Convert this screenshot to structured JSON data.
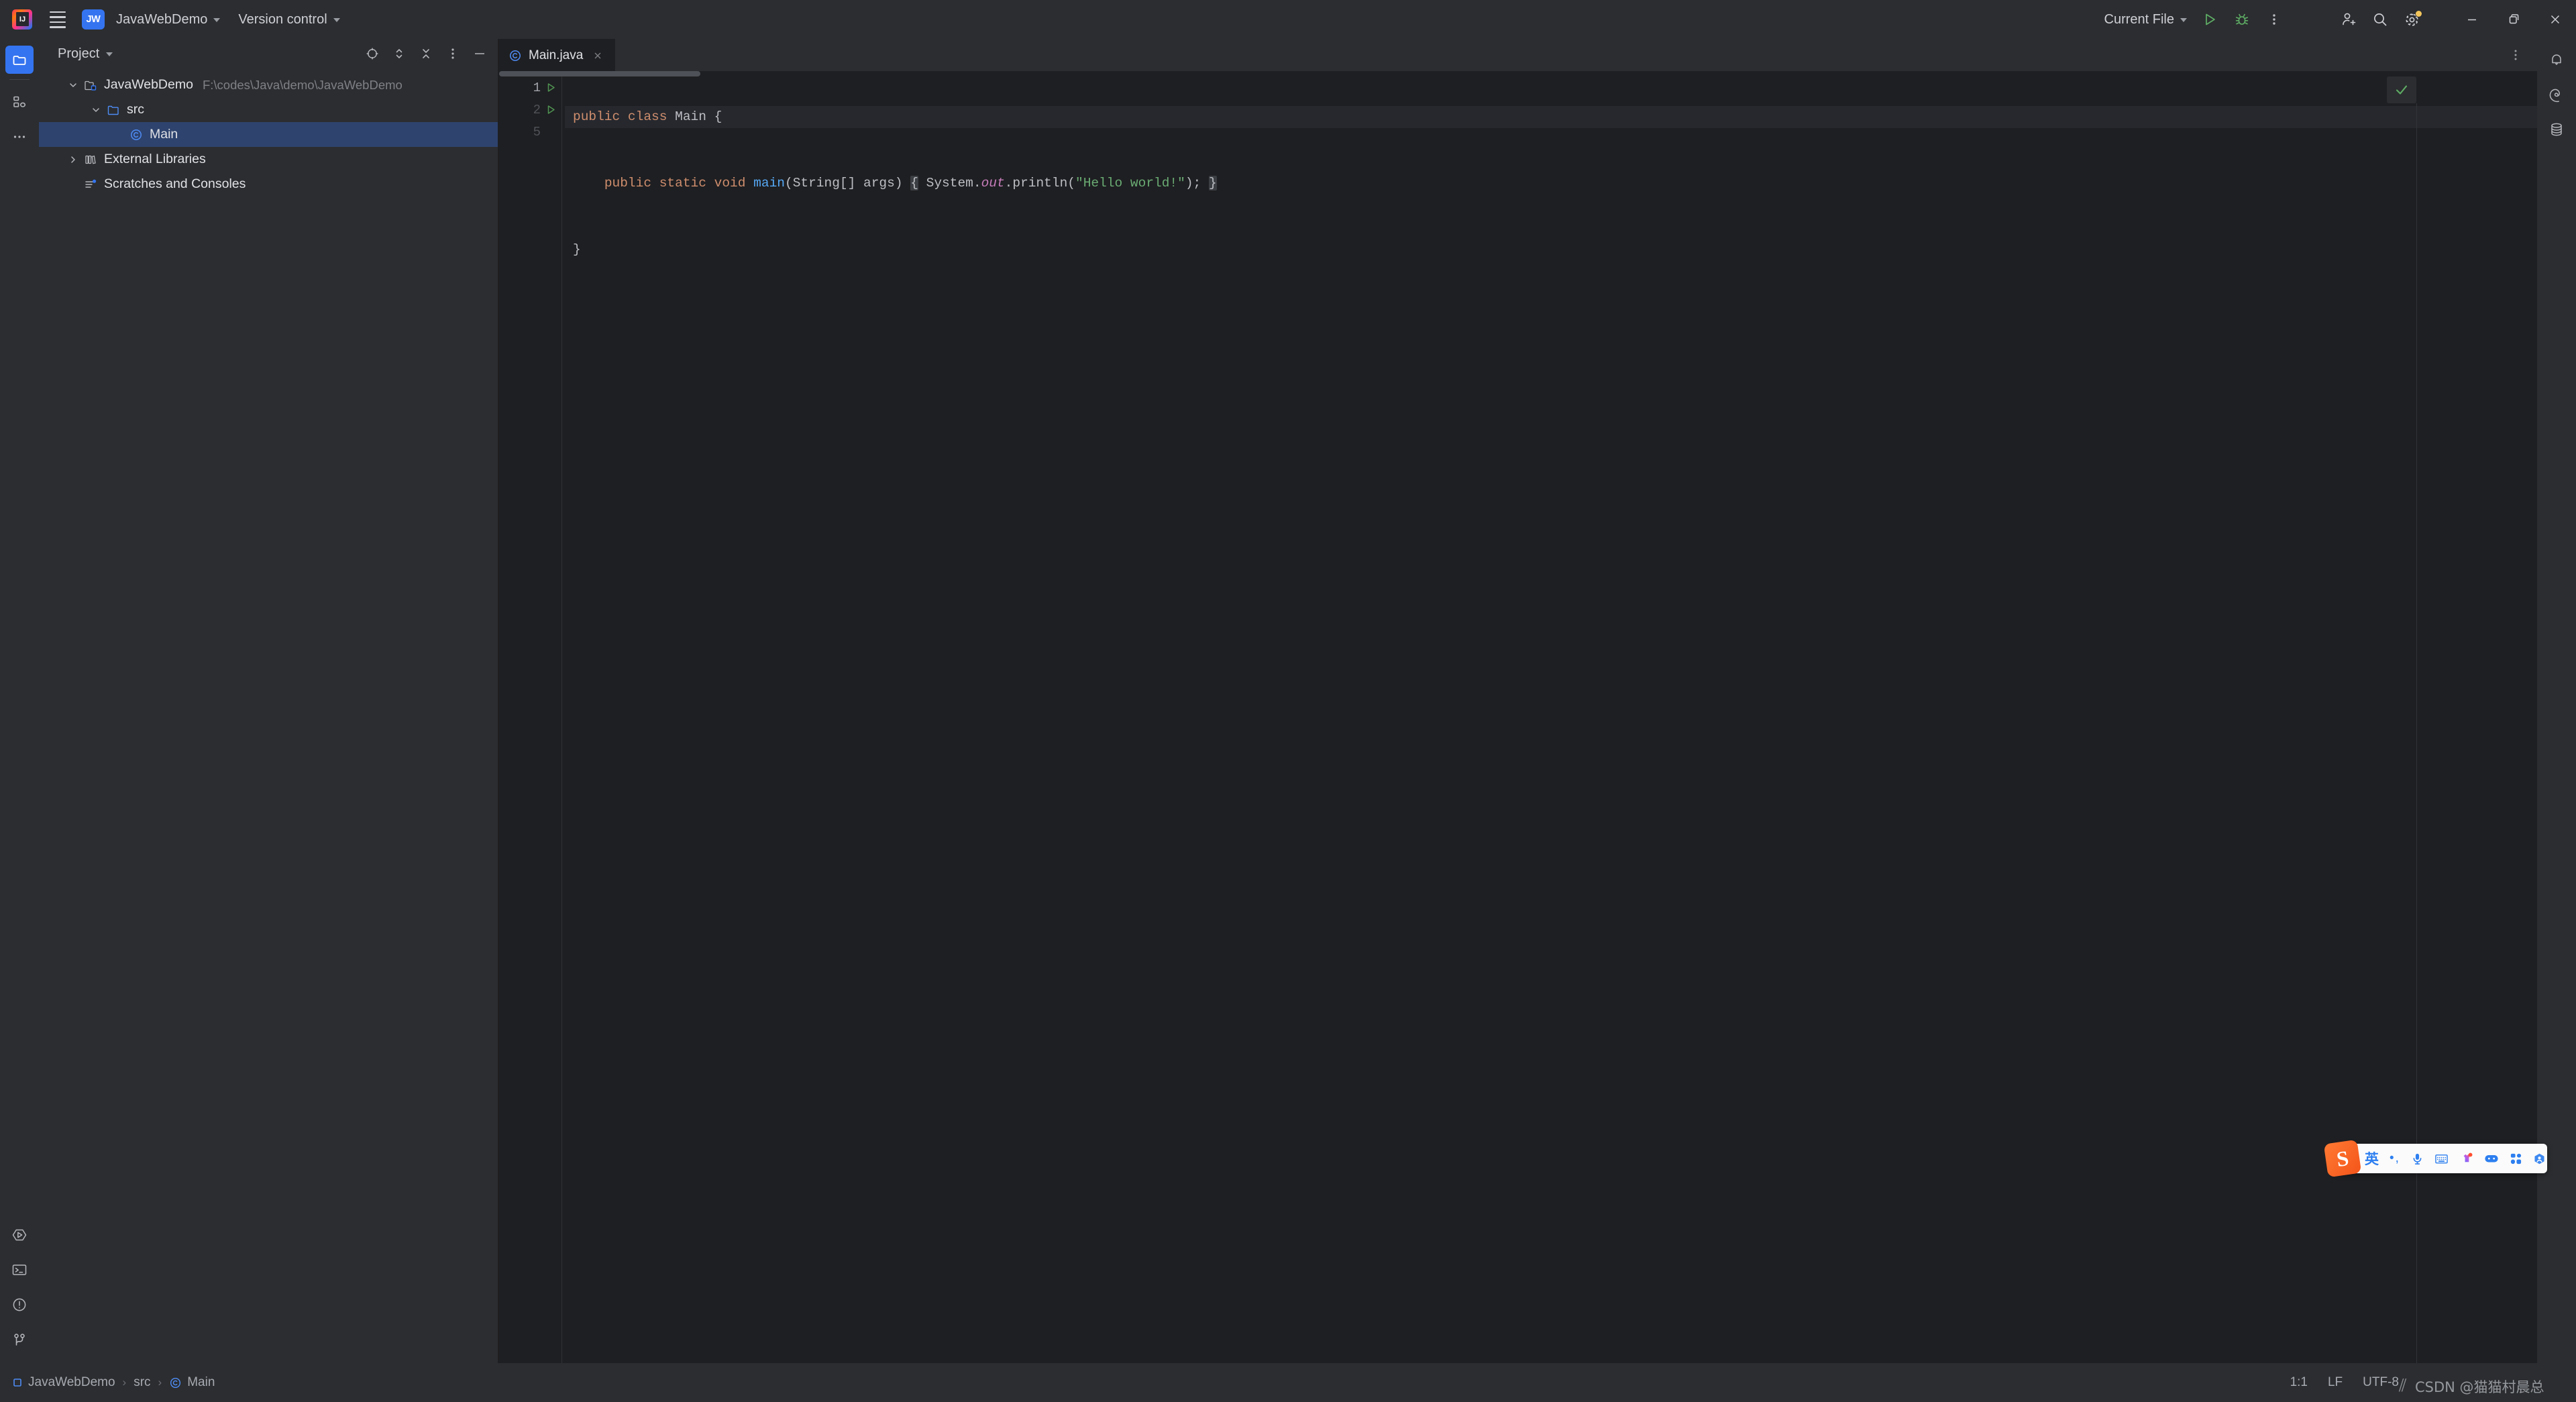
{
  "titlebar": {
    "app_icon": "intellij-idea-logo",
    "menu_icon": "hamburger-menu-icon",
    "project_badge": "JW",
    "project_name": "JavaWebDemo",
    "version_control": "Version control",
    "run_config": "Current File",
    "run_icon": "run-icon",
    "debug_icon": "debug-icon",
    "more_icon": "more-vertical-icon",
    "account_icon": "add-account-icon",
    "search_icon": "search-icon",
    "settings_icon": "settings-gear-icon",
    "minimize_icon": "minimize-icon",
    "maximize_icon": "restore-window-icon",
    "close_icon": "close-window-icon"
  },
  "left_rail": {
    "project_icon": "project-folder-icon",
    "structure_icon": "structure-icon",
    "more_icon": "more-tool-windows-icon",
    "run_icon": "run-tool-icon",
    "terminal_icon": "terminal-icon",
    "problems_icon": "problems-icon",
    "git_icon": "git-branch-icon"
  },
  "project_panel": {
    "title": "Project",
    "title_chevron": "chevron-down-icon",
    "tools": [
      {
        "name": "select-opened-file-icon",
        "label": "Select Opened File"
      },
      {
        "name": "expand-all-icon",
        "label": "Expand All"
      },
      {
        "name": "collapse-all-icon",
        "label": "Collapse All"
      },
      {
        "name": "options-menu-icon",
        "label": "Options"
      },
      {
        "name": "hide-icon",
        "label": "Hide"
      }
    ],
    "tree": [
      {
        "label": "JavaWebDemo",
        "path": "F:\\codes\\Java\\demo\\JavaWebDemo",
        "icon": "module-folder-icon",
        "expanded": true,
        "selected": false,
        "indent": 0
      },
      {
        "label": "src",
        "path": "",
        "icon": "source-folder-icon",
        "expanded": true,
        "selected": false,
        "indent": 1
      },
      {
        "label": "Main",
        "path": "",
        "icon": "java-class-icon",
        "expanded": null,
        "selected": true,
        "indent": 2
      },
      {
        "label": "External Libraries",
        "path": "",
        "icon": "libraries-icon",
        "expanded": false,
        "selected": false,
        "indent": 0
      },
      {
        "label": "Scratches and Consoles",
        "path": "",
        "icon": "scratches-icon",
        "expanded": null,
        "selected": false,
        "indent": 0
      }
    ]
  },
  "editor": {
    "tab": {
      "label": "Main.java",
      "icon": "java-class-icon",
      "close_icon": "close-tab-icon"
    },
    "tabbar_menu_icon": "more-vertical-icon",
    "inspection_status_icon": "inspections-ok-check-icon",
    "lines": [
      {
        "number": "1",
        "current": true,
        "run_marker": true,
        "fold_marker": false,
        "tokens": [
          {
            "text": "public",
            "style": "kw"
          },
          {
            "text": " ",
            "style": "punct"
          },
          {
            "text": "class",
            "style": "kw"
          },
          {
            "text": " ",
            "style": "punct"
          },
          {
            "text": "Main",
            "style": "cls"
          },
          {
            "text": " {",
            "style": "punct"
          }
        ]
      },
      {
        "number": "2",
        "current": false,
        "run_marker": true,
        "fold_marker": true,
        "tokens": [
          {
            "text": "    ",
            "style": "punct"
          },
          {
            "text": "public",
            "style": "kw"
          },
          {
            "text": " ",
            "style": "punct"
          },
          {
            "text": "static",
            "style": "kw"
          },
          {
            "text": " ",
            "style": "punct"
          },
          {
            "text": "void",
            "style": "kw"
          },
          {
            "text": " ",
            "style": "punct"
          },
          {
            "text": "main",
            "style": "method"
          },
          {
            "text": "(",
            "style": "punct"
          },
          {
            "text": "String",
            "style": "type"
          },
          {
            "text": "[] args)",
            "style": "punct"
          },
          {
            "text": " ",
            "style": "punct"
          },
          {
            "text": "{",
            "style": "fold"
          },
          {
            "text": " ",
            "style": "punct"
          },
          {
            "text": "System",
            "style": "type"
          },
          {
            "text": ".",
            "style": "punct"
          },
          {
            "text": "out",
            "style": "field"
          },
          {
            "text": ".println(",
            "style": "punct"
          },
          {
            "text": "\"Hello world!\"",
            "style": "str"
          },
          {
            "text": ");",
            "style": "punct"
          },
          {
            "text": " ",
            "style": "punct"
          },
          {
            "text": "}",
            "style": "fold"
          }
        ]
      },
      {
        "number": "5",
        "current": false,
        "run_marker": false,
        "fold_marker": false,
        "tokens": [
          {
            "text": "}",
            "style": "punct"
          }
        ]
      }
    ]
  },
  "right_rail": {
    "notifications_icon": "notifications-bell-icon",
    "ai_assistant_icon": "ai-assistant-icon",
    "database_icon": "database-icon"
  },
  "statusbar": {
    "breadcrumb": [
      {
        "label": "JavaWebDemo",
        "icon": "module-square-icon"
      },
      {
        "label": "src",
        "icon": ""
      },
      {
        "label": "Main",
        "icon": "java-class-icon"
      }
    ],
    "separator": "›",
    "caret_position": "1:1",
    "line_separator": "LF",
    "encoding": "UTF-8"
  },
  "ime_toolbar": {
    "logo": "S",
    "items": [
      {
        "name": "language-mode-chinese",
        "glyph": "英",
        "kind": "cn"
      },
      {
        "name": "punctuation-mode-icon",
        "glyph": "•,",
        "kind": "punc"
      },
      {
        "name": "voice-input-icon",
        "glyph": "",
        "kind": "svg"
      },
      {
        "name": "soft-keyboard-icon",
        "glyph": "",
        "kind": "svg"
      },
      {
        "name": "skin-theme-icon",
        "glyph": "",
        "kind": "svg"
      },
      {
        "name": "game-mode-icon",
        "glyph": "",
        "kind": "svg"
      },
      {
        "name": "toolbox-grid-icon",
        "glyph": "",
        "kind": "svg"
      },
      {
        "name": "sogou-assistant-icon",
        "glyph": "",
        "kind": "svg"
      }
    ]
  },
  "watermark": {
    "text": "CSDN @猫猫村晨总"
  },
  "colors": {
    "accent_blue": "#3574f0",
    "panel_bg": "#2b2d30",
    "editor_bg": "#1e1f22",
    "selection_bg": "#2e436e",
    "keyword": "#cf8e6d",
    "string": "#6aab73",
    "method": "#56a8f5",
    "field": "#c77dbb",
    "run_green": "#499c54"
  }
}
